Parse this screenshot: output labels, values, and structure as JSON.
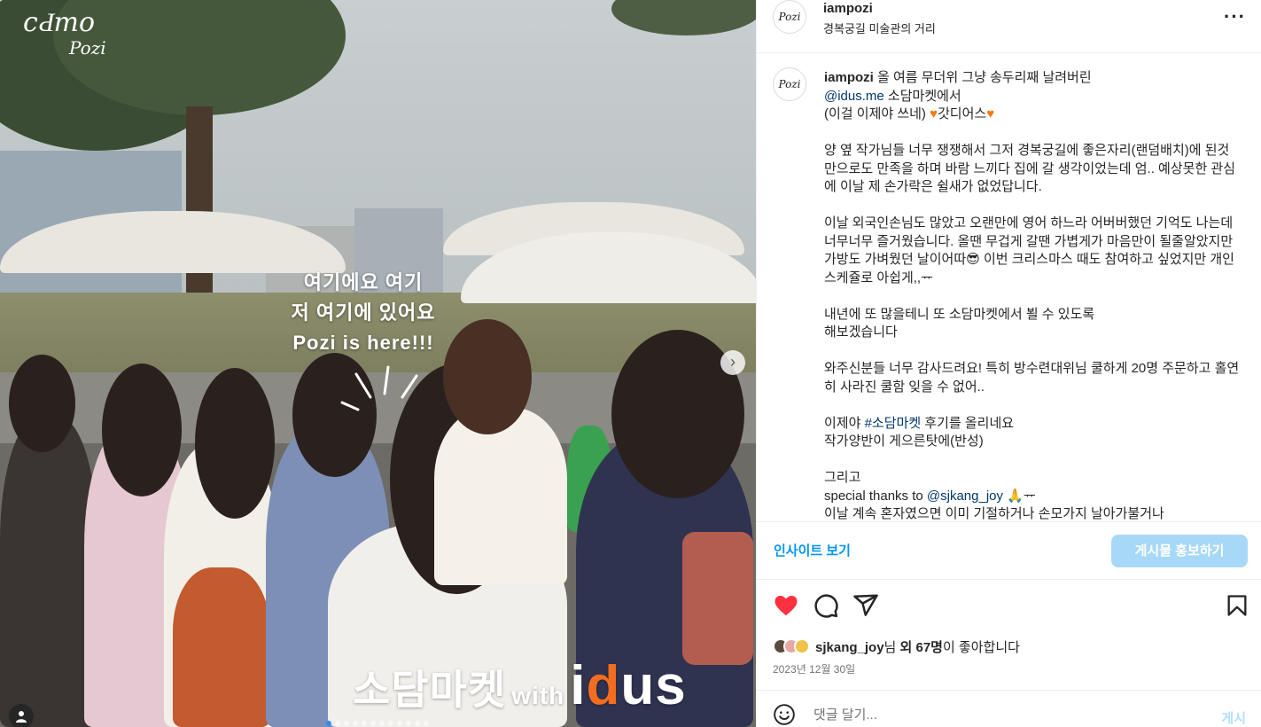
{
  "media": {
    "watermark_line1": "cԀmo",
    "watermark_line2": "Pozi",
    "overlay_lines": [
      "여기에요 여기",
      "저 여기에 있어요",
      "Pozi is here!!!"
    ],
    "brand_text": "소담마켓",
    "brand_with": "with",
    "brand_idus_i": "i",
    "brand_idus_d": "d",
    "brand_idus_us": "us",
    "next_icon": "chevron-right-icon",
    "user_icon": "person-icon",
    "slide_count": 12,
    "slide_active": 1
  },
  "header": {
    "username": "iampozi",
    "location": "경복궁길 미술관의 거리",
    "avatar_text": "Pozi"
  },
  "caption": {
    "username": "iampozi",
    "line1": " 올 여름 무더위 그냥 송두리째 날려버린",
    "mention_idus": "@idus.me",
    "line2_rest": " 소담마켓에서",
    "line3_a": "(이걸 이제야 쓰네) ",
    "line3_heart": "♥",
    "line3_b": "갓디어스",
    "line3_heart2": "♥",
    "para1": "양 옆 작가님들 너무 쟁쟁해서 그저 경복궁길에 좋은자리(랜덤배치)에 된것만으로도 만족을 하며 바람 느끼다 집에 갈 생각이었는데 엄.. 예상못한 관심에 이날 제 손가락은 쉴새가 없었답니다.",
    "para2": "이날 외국인손님도 많았고 오랜만에 영어 하느라 어버버했던 기억도 나는데 너무너무 즐거웠습니다. 올땐 무겁게 갈땐 가볍게가 마음만이 될줄알았지만 가방도 가벼웠던 날이어따😎 이번 크리스마스 때도 참여하고 싶었지만 개인스케쥴로 아쉽게,,ᅲ",
    "para3_line1": "내년에 또 많을테니 또 소담마켓에서 뵐 수 있도록",
    "para3_line2": "해보겠습니다",
    "para4": "와주신분들 너무 감사드려요! 특히 방수련대위님 쿨하게 20명 주문하고 홀연히 사라진 쿨함 잊을 수 없어..",
    "para5_a": "이제야 ",
    "para5_tag": "#소담마켓",
    "para5_b": " 후기를 올리네요",
    "para5_line2": "작가양반이 게으른탓에(반성)",
    "para6_line1": "그리고",
    "para6_line2_a": "special thanks to ",
    "para6_mention": "@sjkang_joy",
    "para6_line2_b": " 🙏ᅲ",
    "para6_line3": "이날 계속 혼자였으면 이미 기절하거나 손모가지 날아가불거나"
  },
  "promo": {
    "insight_label": "인사이트 보기",
    "boost_label": "게시물 홍보하기"
  },
  "actions": {
    "like_icon": "heart-filled-icon",
    "comment_icon": "comment-icon",
    "share_icon": "share-icon",
    "save_icon": "bookmark-icon"
  },
  "likes": {
    "user": "sjkang_joy",
    "mid": "님 ",
    "others": "외 67명",
    "tail": "이 좋아합니다"
  },
  "date": "2023년 12월 30일",
  "comment": {
    "placeholder": "댓글 달기...",
    "post_label": "게시"
  },
  "colors": {
    "link": "#00376b",
    "accent": "#0095f6",
    "like_red": "#ff3040",
    "idus_orange": "#f36d21"
  }
}
